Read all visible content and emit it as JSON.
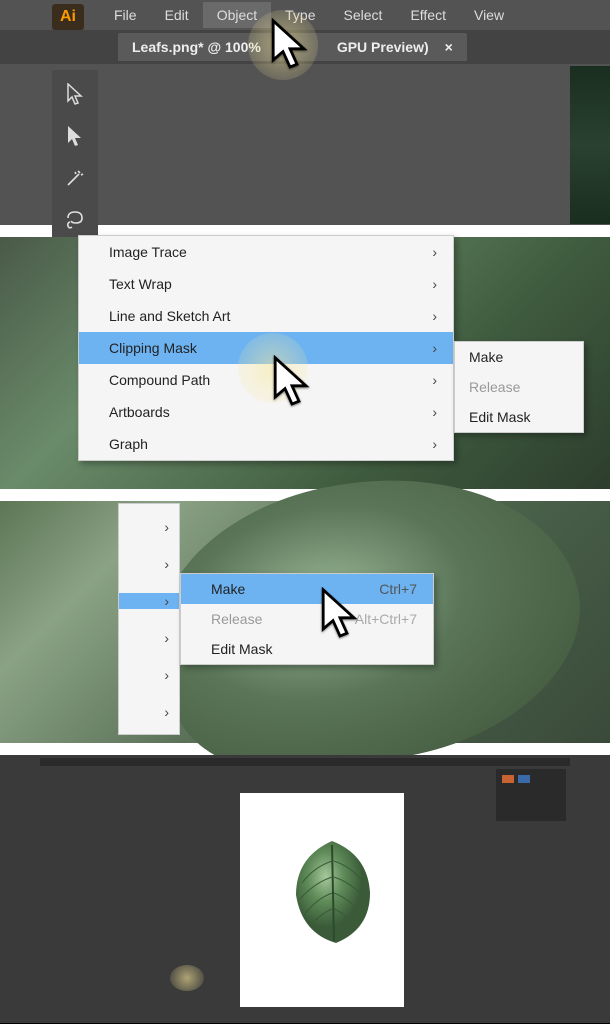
{
  "app": {
    "logo": "Ai"
  },
  "menubar": {
    "items": [
      {
        "label": "File"
      },
      {
        "label": "Edit"
      },
      {
        "label": "Object",
        "active": true
      },
      {
        "label": "Type"
      },
      {
        "label": "Select"
      },
      {
        "label": "Effect"
      },
      {
        "label": "View"
      }
    ]
  },
  "doc_tab": {
    "prefix": "Leafs.png* @ 100%",
    "suffix": "GPU Preview)",
    "close": "×"
  },
  "object_menu": {
    "items": [
      {
        "label": "Image Trace",
        "submenu": true
      },
      {
        "label": "Text Wrap",
        "submenu": true
      },
      {
        "label": "Line and Sketch Art",
        "submenu": true
      },
      {
        "label": "Clipping Mask",
        "submenu": true,
        "highlighted": true
      },
      {
        "label": "Compound Path",
        "submenu": true
      },
      {
        "label": "Artboards",
        "submenu": true
      },
      {
        "label": "Graph",
        "submenu": true
      }
    ]
  },
  "clipping_submenu": {
    "items": [
      {
        "label": "Make"
      },
      {
        "label": "Release",
        "disabled": true
      },
      {
        "label": "Edit Mask"
      }
    ]
  },
  "clipping_submenu_detail": {
    "items": [
      {
        "label": "Make",
        "shortcut": "Ctrl+7",
        "highlighted": true
      },
      {
        "label": "Release",
        "shortcut": "Alt+Ctrl+7",
        "disabled": true
      },
      {
        "label": "Edit Mask",
        "shortcut": ""
      }
    ]
  }
}
